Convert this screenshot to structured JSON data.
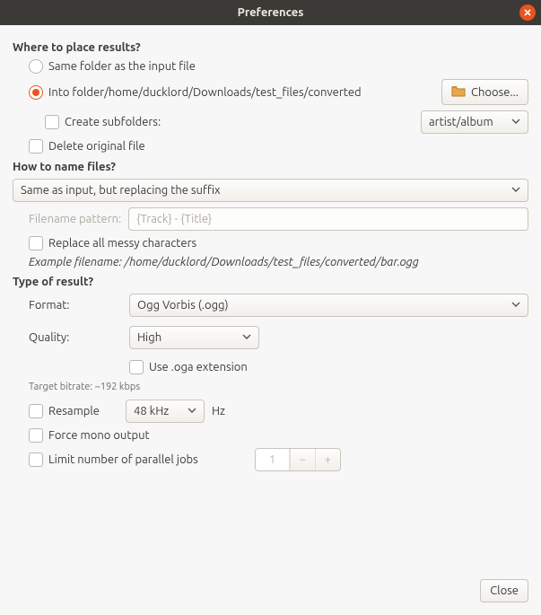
{
  "window": {
    "title": "Preferences"
  },
  "sections": {
    "place": {
      "title": "Where to place results?",
      "same_folder": "Same folder as the input file",
      "into_folder_prefix": "Into folder ",
      "into_folder_path": "/home/ducklord/Downloads/test_files/converted",
      "choose_btn": "Choose...",
      "create_subfolders": "Create subfolders:",
      "subfolder_pattern": "artist/album",
      "delete_original": "Delete original file"
    },
    "naming": {
      "title": "How to name files?",
      "scheme": "Same as input, but replacing the suffix",
      "pattern_label": "Filename pattern:",
      "pattern_placeholder": "{Track} - {Title}",
      "replace_messy": "Replace all messy characters",
      "example_label": "Example filename: ",
      "example_value": "/home/ducklord/Downloads/test_files/converted/bar.ogg"
    },
    "result": {
      "title": "Type of result?",
      "format_label": "Format:",
      "format_value": "Ogg Vorbis (.ogg)",
      "quality_label": "Quality:",
      "quality_value": "High",
      "use_oga": "Use .oga extension",
      "target_bitrate": "Target bitrate: ~192 kbps",
      "resample_label": "Resample",
      "resample_value": "48 kHz",
      "resample_unit": "Hz",
      "force_mono": "Force mono output",
      "limit_jobs": "Limit number of parallel jobs",
      "limit_value": "1"
    }
  },
  "footer": {
    "close": "Close"
  }
}
